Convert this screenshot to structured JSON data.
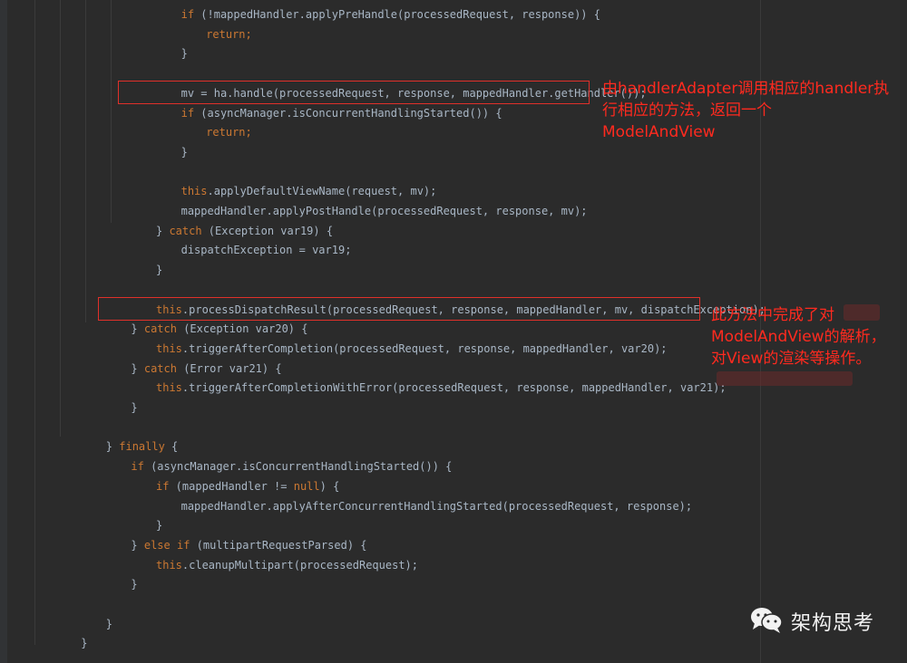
{
  "code": {
    "lines": [
      {
        "indent": 6,
        "segments": [
          [
            "kw",
            "if"
          ],
          [
            "p",
            " (!mappedHandler.applyPreHandle(processedRequest, response)) {"
          ]
        ]
      },
      {
        "indent": 7,
        "segments": [
          [
            "kw",
            "return;"
          ]
        ]
      },
      {
        "indent": 6,
        "segments": [
          [
            "p",
            "}"
          ]
        ]
      },
      {
        "indent": 0,
        "segments": []
      },
      {
        "indent": 6,
        "segments": [
          [
            "p",
            "mv = ha.handle(processedRequest, response, mappedHandler.getHandler());"
          ]
        ]
      },
      {
        "indent": 6,
        "segments": [
          [
            "kw",
            "if"
          ],
          [
            "p",
            " (asyncManager.isConcurrentHandlingStarted()) {"
          ]
        ]
      },
      {
        "indent": 7,
        "segments": [
          [
            "kw",
            "return;"
          ]
        ]
      },
      {
        "indent": 6,
        "segments": [
          [
            "p",
            "}"
          ]
        ]
      },
      {
        "indent": 0,
        "segments": []
      },
      {
        "indent": 6,
        "segments": [
          [
            "kw",
            "this"
          ],
          [
            "p",
            ".applyDefaultViewName(request, mv);"
          ]
        ]
      },
      {
        "indent": 6,
        "segments": [
          [
            "p",
            "mappedHandler.applyPostHandle(processedRequest, response, mv);"
          ]
        ]
      },
      {
        "indent": 5,
        "segments": [
          [
            "p",
            "} "
          ],
          [
            "kw",
            "catch"
          ],
          [
            "p",
            " (Exception var19) {"
          ]
        ]
      },
      {
        "indent": 6,
        "segments": [
          [
            "p",
            "dispatchException = var19;"
          ]
        ]
      },
      {
        "indent": 5,
        "segments": [
          [
            "p",
            "}"
          ]
        ]
      },
      {
        "indent": 0,
        "segments": []
      },
      {
        "indent": 5,
        "segments": [
          [
            "kw",
            "this"
          ],
          [
            "p",
            ".processDispatchResult(processedRequest, response, mappedHandler, mv, dispatchException);"
          ]
        ]
      },
      {
        "indent": 4,
        "segments": [
          [
            "p",
            "} "
          ],
          [
            "kw",
            "catch"
          ],
          [
            "p",
            " (Exception var20) {"
          ]
        ]
      },
      {
        "indent": 5,
        "segments": [
          [
            "kw",
            "this"
          ],
          [
            "p",
            ".triggerAfterCompletion(processedRequest, response, mappedHandler, var20);"
          ]
        ]
      },
      {
        "indent": 4,
        "segments": [
          [
            "p",
            "} "
          ],
          [
            "kw",
            "catch"
          ],
          [
            "p",
            " (Error var21) {"
          ]
        ]
      },
      {
        "indent": 5,
        "segments": [
          [
            "kw",
            "this"
          ],
          [
            "p",
            ".triggerAfterCompletionWithError(processedRequest, response, mappedHandler, var21);"
          ]
        ]
      },
      {
        "indent": 4,
        "segments": [
          [
            "p",
            "}"
          ]
        ]
      },
      {
        "indent": 0,
        "segments": []
      },
      {
        "indent": 3,
        "segments": [
          [
            "p",
            "} "
          ],
          [
            "kw",
            "finally"
          ],
          [
            "p",
            " {"
          ]
        ]
      },
      {
        "indent": 4,
        "segments": [
          [
            "kw",
            "if"
          ],
          [
            "p",
            " (asyncManager.isConcurrentHandlingStarted()) {"
          ]
        ]
      },
      {
        "indent": 5,
        "segments": [
          [
            "kw",
            "if"
          ],
          [
            "p",
            " (mappedHandler != "
          ],
          [
            "kw",
            "null"
          ],
          [
            "p",
            ") {"
          ]
        ]
      },
      {
        "indent": 6,
        "segments": [
          [
            "p",
            "mappedHandler.applyAfterConcurrentHandlingStarted(processedRequest, response);"
          ]
        ]
      },
      {
        "indent": 5,
        "segments": [
          [
            "p",
            "}"
          ]
        ]
      },
      {
        "indent": 4,
        "segments": [
          [
            "p",
            "} "
          ],
          [
            "kw",
            "else if"
          ],
          [
            "p",
            " (multipartRequestParsed) {"
          ]
        ]
      },
      {
        "indent": 5,
        "segments": [
          [
            "kw",
            "this"
          ],
          [
            "p",
            ".cleanupMultipart(processedRequest);"
          ]
        ]
      },
      {
        "indent": 4,
        "segments": [
          [
            "p",
            "}"
          ]
        ]
      },
      {
        "indent": 0,
        "segments": []
      },
      {
        "indent": 3,
        "segments": [
          [
            "p",
            "}"
          ]
        ]
      },
      {
        "indent": 2,
        "segments": [
          [
            "p",
            "}"
          ]
        ]
      }
    ]
  },
  "annotations": {
    "note1": [
      "由handlerAdapter调用相应的handler执",
      "行相应的方法，返回一个",
      "ModelAndView"
    ],
    "note2": [
      "此方法中完成了对",
      "ModelAndView的解析，",
      "对View的渲染等操作。"
    ]
  },
  "watermark": {
    "icon": "wechat-icon",
    "text": "架构思考"
  },
  "colors": {
    "background": "#2b2b2b",
    "keyword": "#cc7832",
    "text": "#a9b7c6",
    "annotation": "#ff2a1f"
  }
}
